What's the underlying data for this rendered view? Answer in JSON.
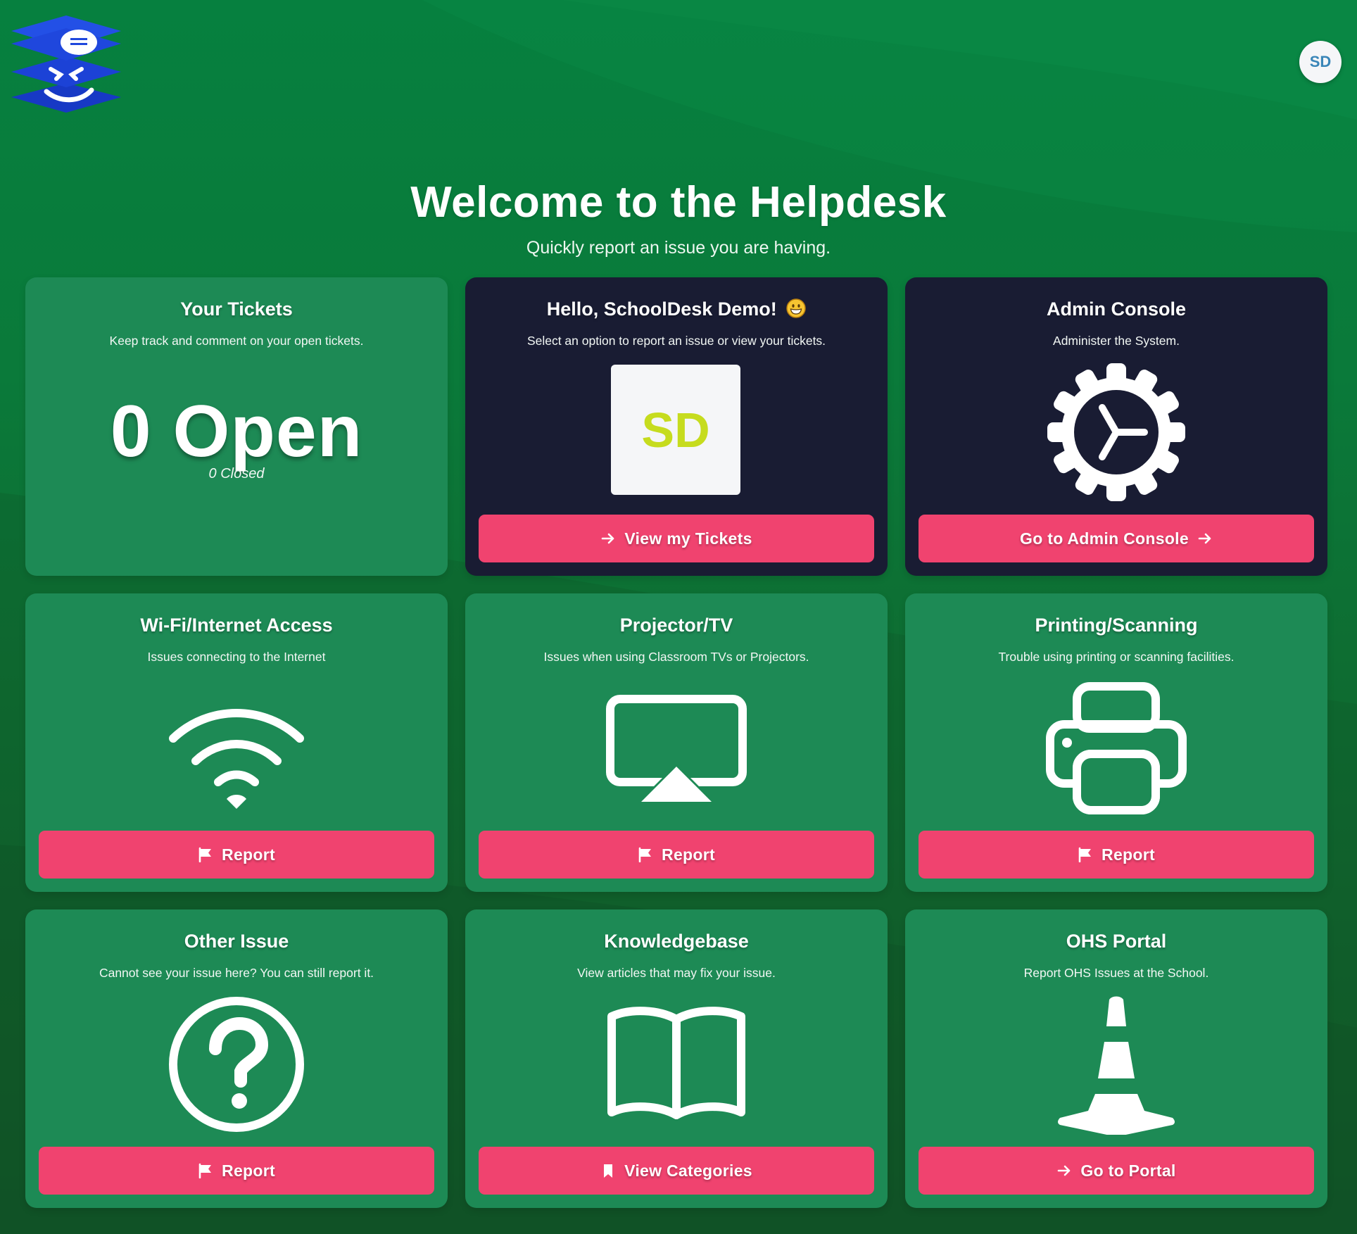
{
  "header": {
    "avatar_initials": "SD"
  },
  "hero": {
    "title": "Welcome to the Helpdesk",
    "subtitle": "Quickly report an issue you are having."
  },
  "tickets_card": {
    "title": "Your Tickets",
    "description": "Keep track and comment on your open tickets.",
    "open_summary": "0 Open",
    "closed_summary": "0 Closed"
  },
  "hello_card": {
    "title": "Hello, SchoolDesk Demo!",
    "description": "Select an option to report an issue or view your tickets.",
    "avatar_initials": "SD",
    "button_label": "View my Tickets"
  },
  "admin_card": {
    "title": "Admin Console",
    "description": "Administer the System.",
    "button_label": "Go to Admin Console"
  },
  "wifi_card": {
    "title": "Wi-Fi/Internet Access",
    "description": "Issues connecting to the Internet",
    "button_label": "Report"
  },
  "projector_card": {
    "title": "Projector/TV",
    "description": "Issues when using Classroom TVs or Projectors.",
    "button_label": "Report"
  },
  "printing_card": {
    "title": "Printing/Scanning",
    "description": "Trouble using printing or scanning facilities.",
    "button_label": "Report"
  },
  "other_card": {
    "title": "Other Issue",
    "description": "Cannot see your issue here? You can still report it.",
    "button_label": "Report"
  },
  "knowledge_card": {
    "title": "Knowledgebase",
    "description": "View articles that may fix your issue.",
    "button_label": "View Categories"
  },
  "ohs_card": {
    "title": "OHS Portal",
    "description": "Report OHS Issues at the School.",
    "button_label": "Go to Portal"
  },
  "colors": {
    "card_green": "#1d8a55",
    "card_dark": "#191c33",
    "button_pink": "#f0436f",
    "sd_yellow": "#c6dc1e",
    "logo_blue": "#1d44d6"
  }
}
